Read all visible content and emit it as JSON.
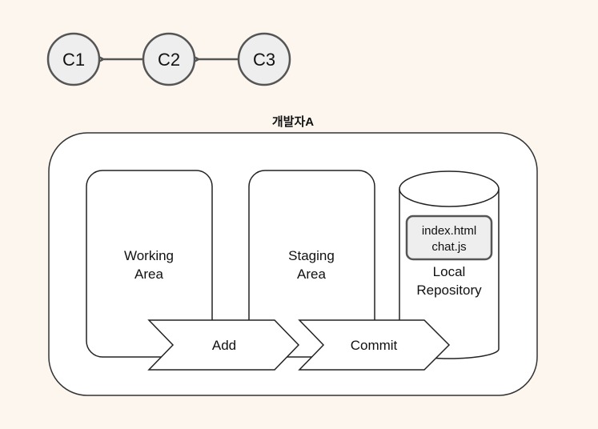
{
  "commits": {
    "nodes": [
      "C1",
      "C2",
      "C3"
    ],
    "arrows": [
      {
        "from": "C2",
        "to": "C1"
      },
      {
        "from": "C3",
        "to": "C2"
      }
    ]
  },
  "developer": {
    "title": "개발자A",
    "working_area": [
      "Working",
      "Area"
    ],
    "staging_area": [
      "Staging",
      "Area"
    ],
    "local_repository": {
      "label": [
        "Local",
        "Repository"
      ],
      "files": [
        "index.html",
        "chat.js"
      ]
    },
    "actions": {
      "add": "Add",
      "commit": "Commit"
    }
  },
  "colors": {
    "background": "#fdf6ee",
    "node_fill": "#eeeeee",
    "node_stroke": "#555555",
    "line": "#222222"
  }
}
